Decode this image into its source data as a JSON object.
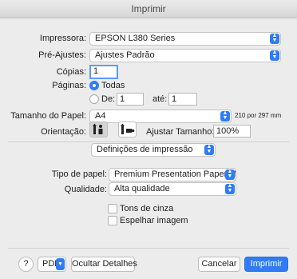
{
  "window": {
    "title": "Imprimir"
  },
  "printer": {
    "label": "Impressora:",
    "value": "EPSON L380 Series"
  },
  "presets": {
    "label": "Pré-Ajustes:",
    "value": "Ajustes Padrão"
  },
  "copies": {
    "label": "Cópias:",
    "value": "1"
  },
  "pages": {
    "label": "Páginas:",
    "all_label": "Todas",
    "all_selected": true,
    "from_label": "De:",
    "from_value": "1",
    "to_label": "até:",
    "to_value": "1"
  },
  "paper_size": {
    "label": "Tamanho do Papel:",
    "value": "A4",
    "dimensions": "210 por 297 mm"
  },
  "orientation": {
    "label": "Orientação:",
    "selected": "portrait"
  },
  "scale": {
    "label": "Ajustar Tamanho:",
    "value": "100%"
  },
  "section_menu": {
    "value": "Definições de impressão"
  },
  "paper_type": {
    "label": "Tipo de papel:",
    "value": "Premium Presentation Paper Matte"
  },
  "quality": {
    "label": "Qualidade:",
    "value": "Alta qualidade"
  },
  "grayscale": {
    "label": "Tons de cinza",
    "checked": false
  },
  "mirror": {
    "label": "Espelhar imagem",
    "checked": false
  },
  "footer": {
    "help_label": "?",
    "pdf_label": "PDF",
    "details_label": "Ocultar Detalhes",
    "cancel_label": "Cancelar",
    "print_label": "Imprimir"
  },
  "colors": {
    "accent": "#2f7cf6",
    "window_bg": "#ececec"
  },
  "icons": {
    "chevron": "up-down-chevron-icon",
    "pdf_menu": "chevron-down-icon",
    "portrait": "portrait-orientation-icon",
    "landscape": "landscape-orientation-icon"
  }
}
